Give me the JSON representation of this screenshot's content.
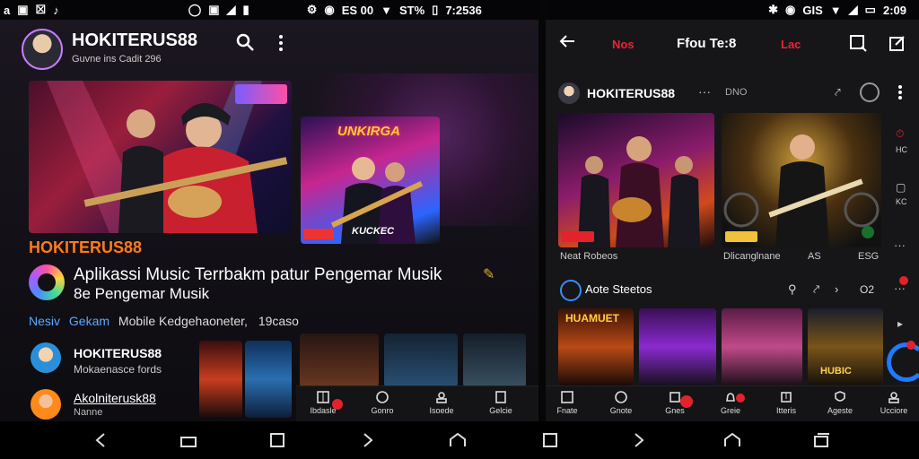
{
  "status_left": {
    "icons": [
      "a-icon",
      "image-icon",
      "close-box-icon",
      "music-note-icon"
    ],
    "center": [
      "circle-icon",
      "square-icon",
      "signal-icon",
      "battery-icon"
    ]
  },
  "status_mid": {
    "text": "ES 00",
    "extra": "ST%",
    "time": "7:2536"
  },
  "status_right": {
    "text": "GIS",
    "time": "2:09"
  },
  "left": {
    "app_title": "HOKITERUS88",
    "app_subtitle": "Guvne ins Cadit 296",
    "hero_brand": "HOKITERUS88",
    "hero_title": "Aplikassi Music Terrbakm patur Pengemar Musik",
    "hero_sub": "8e Pengemar Musik",
    "meta_line": {
      "part1": "Nesiv",
      "part2": "Gekam",
      "part3": "Mobile Kedgehaoneter,",
      "part4": "19caso"
    },
    "list": [
      {
        "title": "HOKITERUS88",
        "subtitle": "Mokaenasce fords"
      },
      {
        "title": "Akolniterusk88",
        "subtitle": "Nanne"
      }
    ],
    "poster_caption": "UNKIRGA",
    "poster_bottom": "KUCKEC",
    "tabs": [
      "Ibdasle",
      "Gonro",
      "Isoede",
      "Gelcie"
    ]
  },
  "right": {
    "header_left": "Nos",
    "header_center": "Ffou Te:8",
    "header_right": "Lac",
    "channel_name": "HOKITERUS88",
    "channel_meta": "DNO",
    "card1_caption": "Neat Robeos",
    "card2_caption": "Dlicanglnane",
    "card2_value": "AS",
    "card2_extra": "ESG",
    "side1": "HC",
    "side2": "KC",
    "section_title": "Aote Steetos",
    "section_right": "O2",
    "tabs": [
      "Fnate",
      "Gnote",
      "Gnes",
      "Greie",
      "Itteris",
      "Ageste",
      "Ucciore"
    ],
    "poster_labels": [
      "HUAMUET",
      "",
      "",
      "HUBIC"
    ]
  },
  "colors": {
    "accent": "#e3222c",
    "brand_orange": "#ff7a1a",
    "link_blue": "#5aa9ff"
  }
}
